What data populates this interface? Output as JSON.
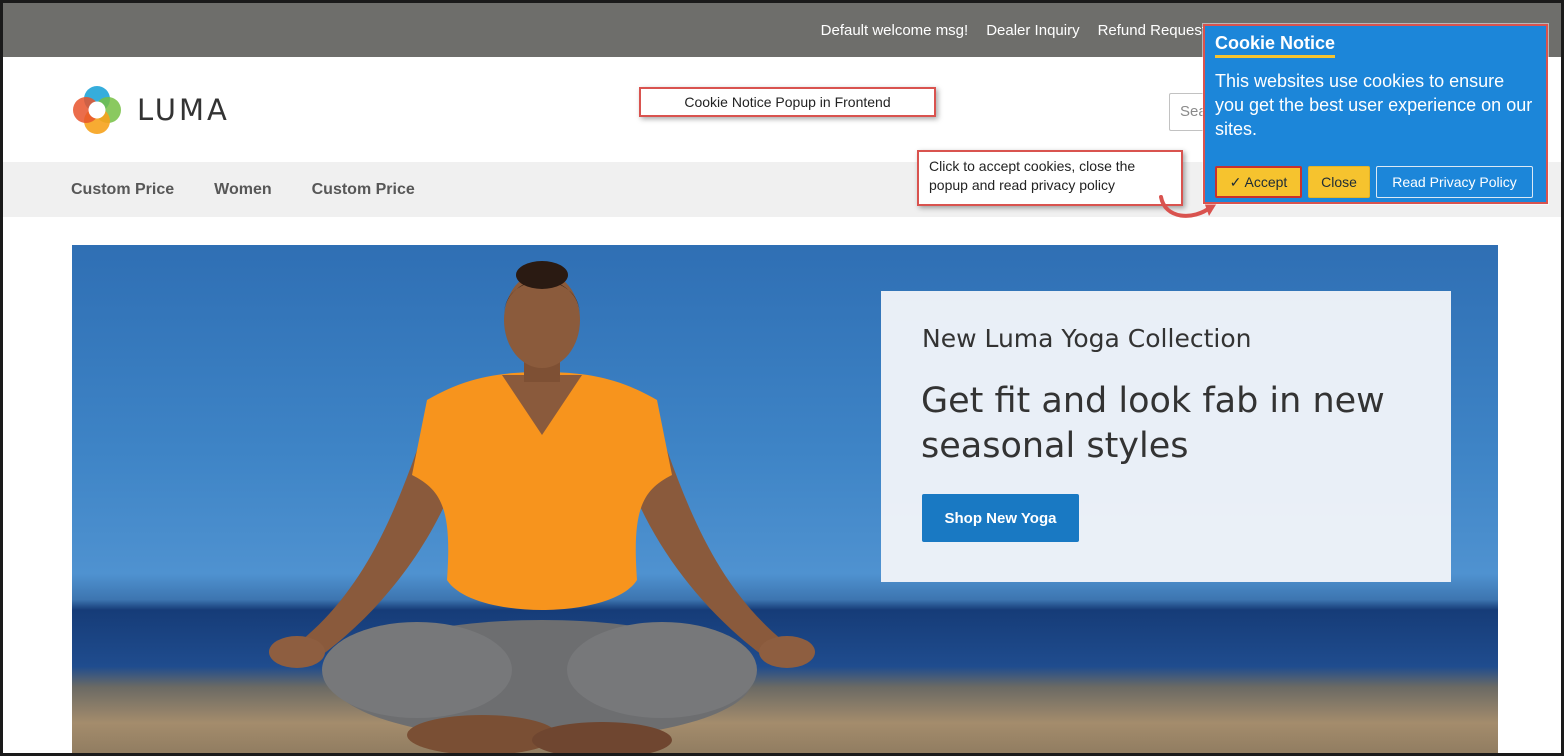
{
  "topbar": {
    "links": [
      "Default welcome msg!",
      "Dealer Inquiry",
      "Refund Request"
    ]
  },
  "header": {
    "logo_text": "LUMA",
    "search_placeholder": "Search"
  },
  "annotations": {
    "top_label": "Cookie Notice Popup in Frontend",
    "action_label": "Click to accept cookies, close the popup and read privacy policy"
  },
  "nav": {
    "items": [
      "Custom Price",
      "Women",
      "Custom Price"
    ]
  },
  "hero": {
    "subtitle": "New Luma Yoga Collection",
    "title": "Get fit and look fab in new seasonal styles",
    "cta": "Shop New Yoga"
  },
  "cookie_notice": {
    "title": "Cookie Notice",
    "message": "This websites use cookies to ensure you get the best user experience on our sites.",
    "accept_label": "✓ Accept",
    "close_label": "Close",
    "policy_label": "Read Privacy Policy"
  },
  "colors": {
    "topbar_bg": "#6e6e6b",
    "nav_bg": "#f0f0f0",
    "primary_button": "#1979c3",
    "cookie_bg": "#1c86d9",
    "cookie_accent": "#f6c32e",
    "annotation_border": "#d9534f"
  }
}
